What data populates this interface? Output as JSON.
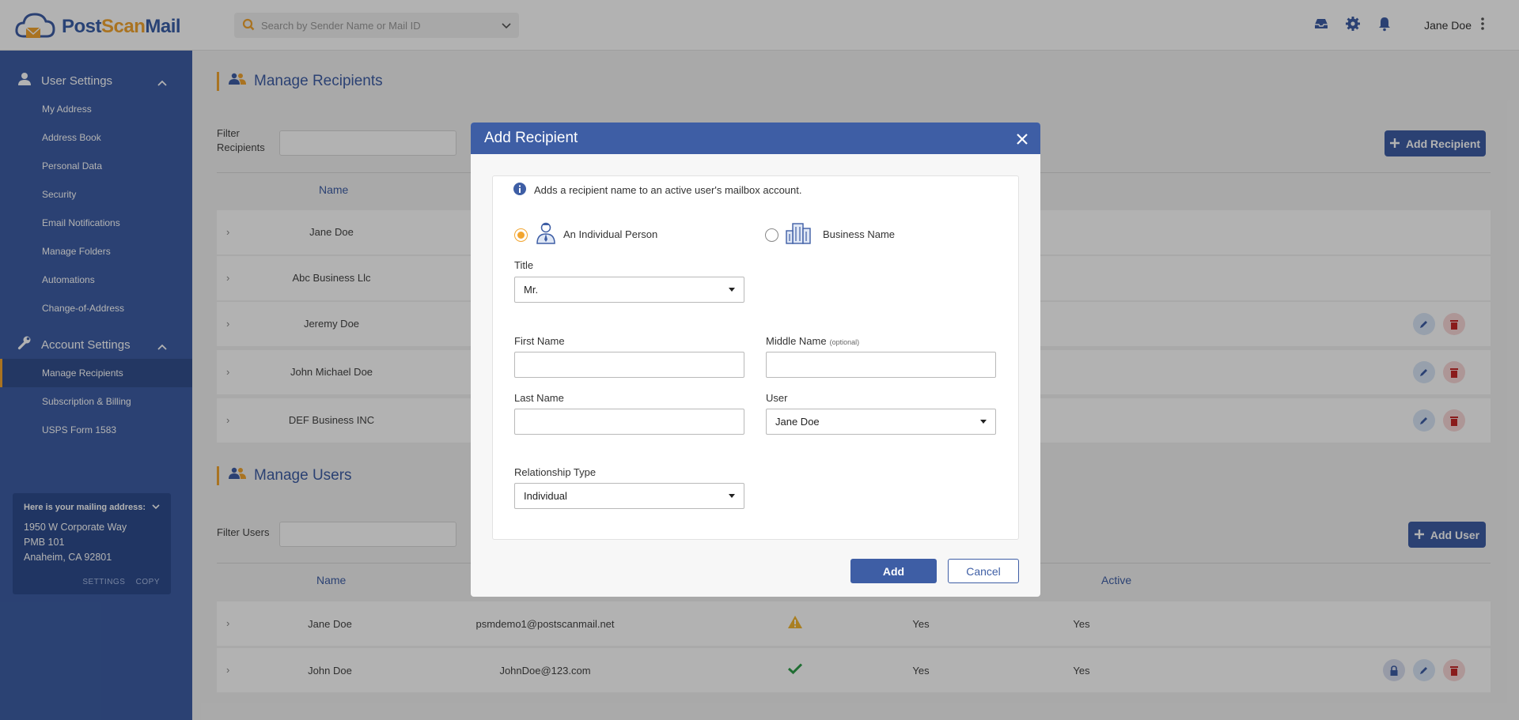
{
  "header": {
    "logo": "PostScanMail",
    "logo_post": "Post",
    "logo_scan": "Scan",
    "logo_mail": "Mail",
    "search_placeholder": "Search by Sender Name or Mail ID",
    "user_name": "Jane Doe"
  },
  "sidebar": {
    "user_settings": {
      "label": "User Settings",
      "items": [
        "My Address",
        "Address Book",
        "Personal Data",
        "Security",
        "Email Notifications",
        "Manage Folders",
        "Automations",
        "Change-of-Address"
      ]
    },
    "account_settings": {
      "label": "Account Settings",
      "items": [
        "Manage Recipients",
        "Subscription & Billing",
        "USPS Form 1583"
      ],
      "active": "Manage Recipients"
    },
    "mailing": {
      "heading": "Here is your mailing address:",
      "line1": "1950 W Corporate Way",
      "line2": "PMB 101",
      "line3": "Anaheim, CA 92801",
      "settings": "SETTINGS",
      "copy": "COPY"
    }
  },
  "recipients": {
    "title": "Manage Recipients",
    "filter_label": "Filter\nRecipients",
    "filter_label_1": "Filter",
    "filter_label_2": "Recipients",
    "add_button": "Add Recipient",
    "col_name": "Name",
    "rows": [
      "Jane Doe",
      "Abc Business Llc",
      "Jeremy Doe",
      "John Michael Doe",
      "DEF Business INC"
    ]
  },
  "users": {
    "title": "Manage Users",
    "filter_label": "Filter Users",
    "add_button": "Add User",
    "col_name": "Name",
    "col_active": "Active",
    "rows": [
      {
        "name": "Jane Doe",
        "email": "psmdemo1@postscanmail.net",
        "col3": "Yes",
        "active": "Yes"
      },
      {
        "name": "John Doe",
        "email": "JohnDoe@123.com",
        "col3": "Yes",
        "active": "Yes"
      }
    ]
  },
  "modal": {
    "title": "Add Recipient",
    "info": "Adds a recipient name to an active user's mailbox account.",
    "type_individual": "An Individual Person",
    "type_business": "Business Name",
    "title_label": "Title",
    "title_value": "Mr.",
    "first_name_label": "First Name",
    "first_name_value": "",
    "middle_name_label": "Middle Name",
    "middle_name_optional": "(optional)",
    "middle_name_value": "",
    "last_name_label": "Last Name",
    "last_name_value": "",
    "user_label": "User",
    "user_value": "Jane Doe",
    "relationship_label": "Relationship Type",
    "relationship_value": "Individual",
    "add_button": "Add",
    "cancel_button": "Cancel"
  },
  "colors": {
    "brand_blue": "#3e5ea5",
    "accent_orange": "#f2a530",
    "danger": "#c62828",
    "success": "#2e9e4a",
    "warning": "#f2b632"
  }
}
